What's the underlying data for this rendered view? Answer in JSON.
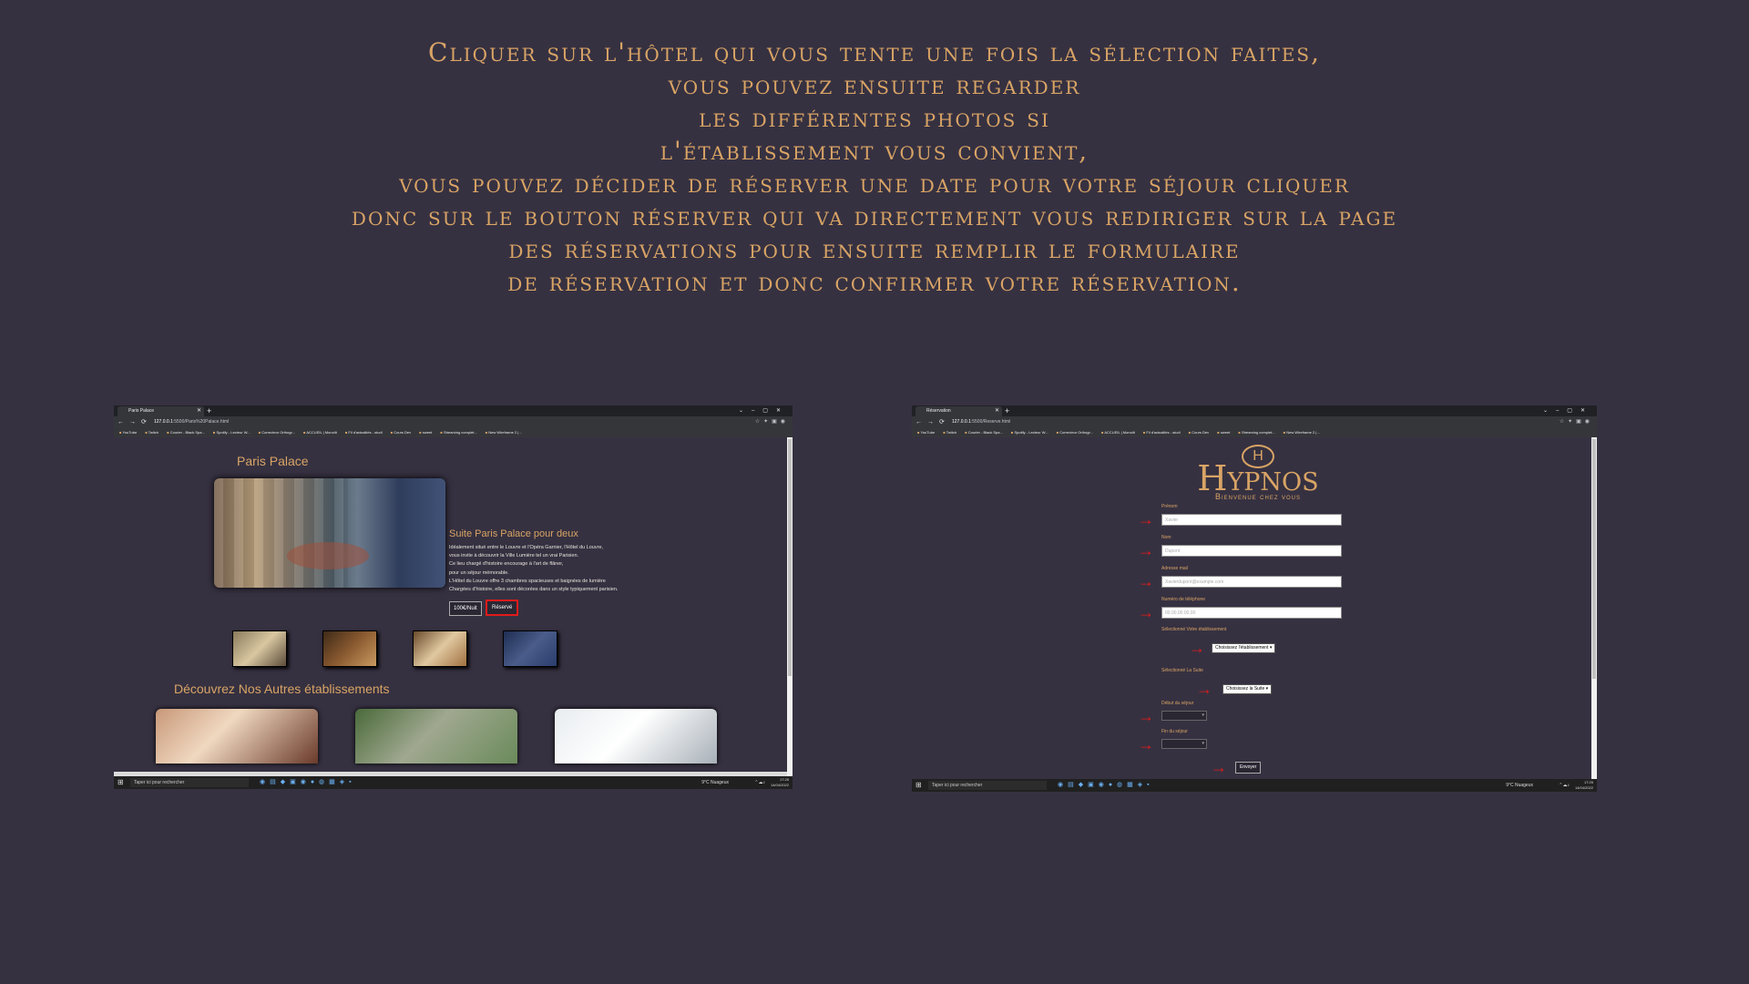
{
  "intro": {
    "lines": [
      "Cliquer sur l'hôtel qui vous tente une fois la sélection faites,",
      "vous pouvez ensuite regarder",
      "les différentes photos si",
      "l'établissement vous convient,",
      "vous pouvez décider de réserver une date pour votre séjour cliquer",
      "donc sur le bouton réserver qui va directement vous rediriger sur la page",
      "des réservations pour ensuite remplir le formulaire",
      "de réservation et donc confirmer votre réservation."
    ]
  },
  "colors": {
    "background": "#363141",
    "accent": "#d9a465",
    "highlight": "#e01b1b"
  },
  "left_screenshot": {
    "tab_title": "Paris Palace",
    "url_host": "127.0.0.1",
    "url_path": ":5500/Paris%20Palace.html",
    "bookmarks": [
      "YouTube",
      "Twitch",
      "Courier - Black Spa...",
      "Spotify - Lecteur W...",
      "Correcteur Orthogr...",
      "ACCUEIL | Monolit",
      "Fil d'actualités - studi",
      "Cours Dev",
      "sweet",
      "Streaming complet...",
      "New Wireframe 2 |..."
    ],
    "page": {
      "title": "Paris Palace",
      "suite_title": "Suite Paris Palace pour deux",
      "description_lines": [
        "Idéalement situé entre le Louvre et l'Opéra Garnier, l'Hôtel du Louvre,",
        "vous invite à découvrir la Ville Lumière tel un vrai Parisien.",
        "Ce lieu chargé d'histoire encourage à l'art de flâner,",
        "pour un séjour mémorable.",
        "L'Hôtel du Louvre offre 3 chambres spacieuses et baignées de lumière",
        "Chargées d'histoire, elles sont décorées dans un style typiquement parisien."
      ],
      "price_label": "100€/Nuit",
      "reserve_label": "Réservé",
      "other_title": "Découvrez Nos Autres établissements"
    },
    "taskbar_search": "Taper ici pour rechercher",
    "weather": "9°C Nuageux",
    "time": "17:25",
    "date": "14/04/2022"
  },
  "right_screenshot": {
    "tab_title": "Réservation",
    "url_host": "127.0.0.1",
    "url_path": ":5500/Reserve.html",
    "bookmarks": [
      "YouTube",
      "Twitch",
      "Courier - Black Spa...",
      "Spotify - Lecteur W...",
      "Correcteur Orthogr...",
      "ACCUEIL | Monolit",
      "Fil d'actualités - studi",
      "Cours Dev",
      "sweet",
      "Streaming complet...",
      "New Wireframe 2 |..."
    ],
    "page": {
      "logo_monogram": "H",
      "brand": "Hypnos",
      "welcome": "Bienvenue chez vous",
      "firstname_label": "Prénom",
      "firstname_placeholder": "Xavier",
      "lastname_label": "Nom",
      "lastname_placeholder": "Dupont",
      "email_label": "Adresse mail",
      "email_placeholder": "Xavierdupont@example.com",
      "phone_label": "Numéro de téléphone",
      "phone_placeholder": "00.00.00.00.00",
      "establishment_label": "Sélectionné Votre établissement",
      "establishment_select": "Choisissez l'établissement",
      "suite_label": "Sélectionné La Suite",
      "suite_select": "Choisissez la Suite",
      "start_label": "Début du séjour",
      "end_label": "Fin du séjour",
      "submit_label": "Envoyer"
    },
    "taskbar_search": "Taper ici pour rechercher",
    "weather": "9°C Nuageux",
    "time": "17:25",
    "date": "14/04/2022"
  }
}
